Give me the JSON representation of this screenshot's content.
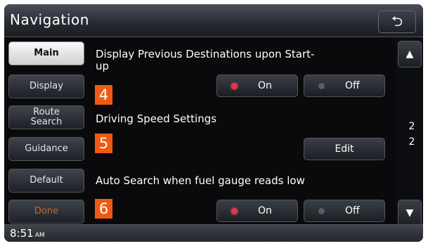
{
  "header": {
    "title": "Navigation",
    "back_icon": "back-arrow-icon"
  },
  "sidebar": {
    "items": [
      {
        "label": "Main"
      },
      {
        "label": "Display"
      },
      {
        "label": "Route Search"
      },
      {
        "label": "Guidance"
      },
      {
        "label": "Default"
      },
      {
        "label": "Done"
      }
    ]
  },
  "settings": [
    {
      "badge": "4",
      "label": "Display Previous Destinations upon Start-up",
      "on_label": "On",
      "off_label": "Off",
      "selected": "On"
    },
    {
      "badge": "5",
      "label": "Driving Speed Settings",
      "edit_label": "Edit"
    },
    {
      "badge": "6",
      "label": "Auto Search when fuel gauge reads low",
      "on_label": "On",
      "off_label": "Off",
      "selected": "On"
    }
  ],
  "scroll": {
    "up_icon": "scroll-up-arrow-icon",
    "down_icon": "scroll-down-arrow-icon",
    "page_current": "2",
    "page_total": "2"
  },
  "status": {
    "time": "8:51",
    "ampm": "AM"
  },
  "colors": {
    "badge": "#ee5a12",
    "on_indicator": "#e8354a",
    "done_text": "#c8652a"
  }
}
